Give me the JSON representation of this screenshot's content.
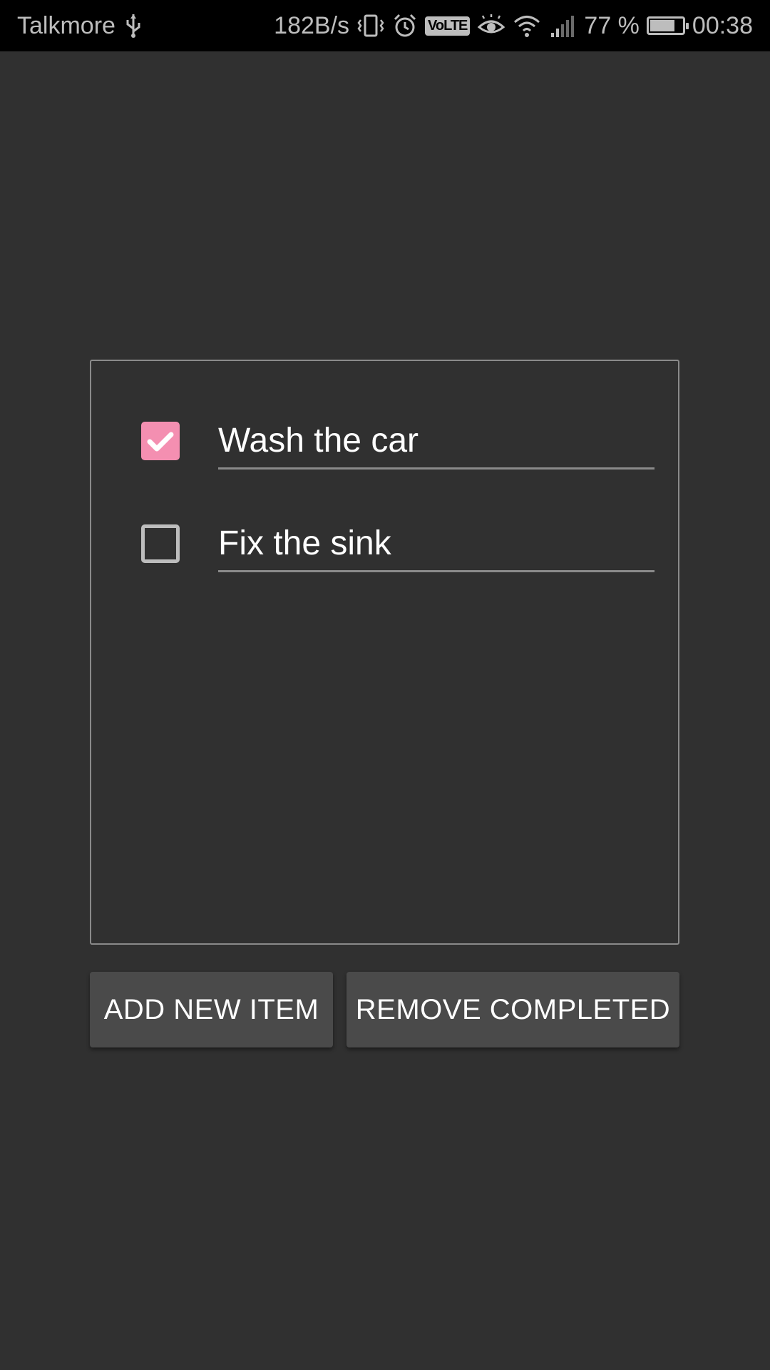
{
  "status_bar": {
    "carrier": "Talkmore",
    "usb_icon": "usb-icon",
    "net_speed": "182B/s",
    "volte_label": "VoLTE",
    "battery_percent": "77 %",
    "battery_level": 0.77,
    "time": "00:38"
  },
  "todo": {
    "items": [
      {
        "text": "Wash the car",
        "checked": true
      },
      {
        "text": "Fix the sink",
        "checked": false
      }
    ],
    "accent_color": "#f48fb1"
  },
  "actions": {
    "add_label": "ADD NEW ITEM",
    "remove_label": "REMOVE COMPLETED"
  }
}
